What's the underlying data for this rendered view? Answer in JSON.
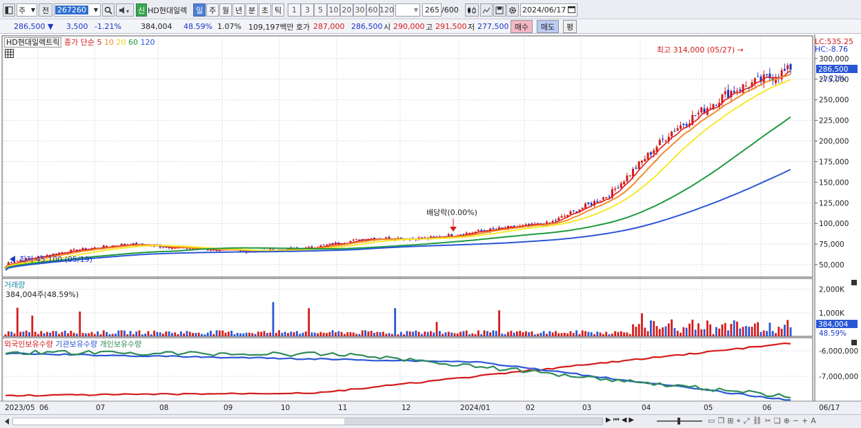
{
  "toolbar": {
    "type_select": "주",
    "prev_label": "전",
    "stock_code": "267260",
    "credit_badge": "신",
    "stock_name": "HD현대일렉",
    "period_tabs": [
      "일",
      "주",
      "월",
      "년",
      "분",
      "초",
      "틱"
    ],
    "interval_buttons": [
      "1",
      "3",
      "5",
      "10",
      "20",
      "30",
      "60",
      "120"
    ],
    "count_value": "265",
    "count_total": "/600",
    "date_value": "2024/06/17"
  },
  "quote": {
    "price": "286,500",
    "change": "3,500",
    "change_pct": "-1.21%",
    "volume": "384,004",
    "vol_ratio": "48.59%",
    "turnover": "1.07%",
    "trade_value": "109,197백만",
    "bid_label": "호가",
    "bid": "287,000",
    "ask": "286,500",
    "open_label": "시",
    "open": "290,000",
    "high_label": "고",
    "high": "291,500",
    "low_label": "저",
    "low": "277,500",
    "buy_button": "매수",
    "sell_button": "매도",
    "eval_button": "평"
  },
  "price_panel": {
    "stock_tag": "HD현대일렉트릭",
    "ma_title": "종가 단순",
    "ma_periods": [
      "5",
      "10",
      "20",
      "60",
      "120"
    ],
    "ma_colors": [
      "#e01b1b",
      "#f08c2a",
      "#f6e92c",
      "#1e9a3c",
      "#2a56d6"
    ],
    "lc_label": "LC:535.25",
    "hc_label": "HC:-8.76",
    "current_price_tag": "286,500",
    "current_change_tag": "-1.21%",
    "high_annotation": "최고 314,000 (05/27) →",
    "low_annotation": "최저 45,100 (05/19)",
    "dividend_annotation": "배당락(0.00%)",
    "y_ticks": [
      "300,000",
      "275,000",
      "250,000",
      "225,000",
      "200,000",
      "175,000",
      "150,000",
      "125,000",
      "100,000",
      "75,000",
      "50,000"
    ]
  },
  "volume_panel": {
    "title": "거래량",
    "value_text": "384,004주(48.59%)",
    "y_ticks": [
      "2,000K",
      "1,000K"
    ],
    "current_tag": "384,004",
    "current_pct": "48.59%"
  },
  "holdings_panel": {
    "legend": [
      "외국인보유수량",
      "기관보유수량",
      "개인보유수량"
    ],
    "legend_colors": [
      "#d41a1a",
      "#2a56d6",
      "#2e8b57"
    ],
    "y_ticks": [
      "-6,000,000",
      "-7,000,000"
    ]
  },
  "x_axis": [
    "2023/05",
    "06",
    "07",
    "08",
    "09",
    "10",
    "11",
    "12",
    "2024/01",
    "02",
    "03",
    "04",
    "05",
    "06"
  ],
  "x_axis_end": "06/17",
  "chart_data": {
    "type": "candlestick",
    "price_ylim": [
      35000,
      325000
    ],
    "monthly_close": [
      {
        "month": "2023/05",
        "value": 52000
      },
      {
        "month": "06",
        "value": 66000
      },
      {
        "month": "07",
        "value": 75000
      },
      {
        "month": "08",
        "value": 70000
      },
      {
        "month": "09",
        "value": 66000
      },
      {
        "month": "10",
        "value": 70000
      },
      {
        "month": "11",
        "value": 82000
      },
      {
        "month": "12",
        "value": 82000
      },
      {
        "month": "2024/01",
        "value": 92000
      },
      {
        "month": "02",
        "value": 100000
      },
      {
        "month": "03",
        "value": 135000
      },
      {
        "month": "04",
        "value": 210000
      },
      {
        "month": "05",
        "value": 260000
      },
      {
        "month": "06",
        "value": 286500
      }
    ],
    "high": {
      "value": 314000,
      "date": "05/27"
    },
    "low": {
      "value": 45100,
      "date": "05/19"
    },
    "current": 286500
  }
}
